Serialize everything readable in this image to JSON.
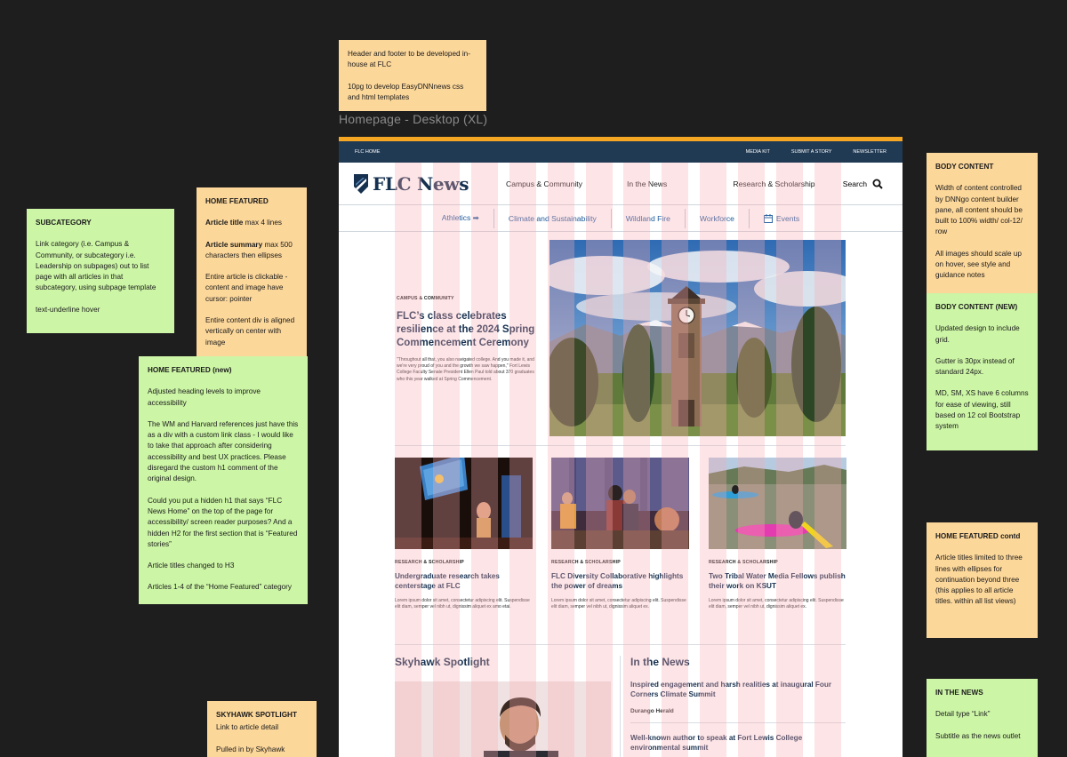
{
  "frame_label": "Homepage - Desktop (XL)",
  "notes": {
    "header_footer": {
      "line1": "Header and footer to be developed in-house at FLC",
      "line2": "10pg to develop EasyDNNnews css and html templates"
    },
    "subcategory": {
      "title": "SUBCATEGORY",
      "p1": "Link category (i.e. Campus & Community, or subcategory i.e. Leadership on subpages) out to list page with all articles in that subcategory, using subpage template",
      "p2": "text-underline hover"
    },
    "home_featured": {
      "title": "HOME FEATURED",
      "p1_bold": "Article title",
      "p1_rest": " max 4 lines",
      "p2_bold": "Article summary",
      "p2_rest": " max 500 characters then ellipses",
      "p3": "Entire article is clickable - content and image have cursor: pointer",
      "p4": "Entire content div is aligned vertically on center with image"
    },
    "home_featured_new": {
      "title": "HOME FEATURED (new)",
      "p1": "Adjusted heading levels to improve accessibility",
      "p2": "The WM and Harvard references just have this as a div with a custom link class - I would like to take that approach after considering accessibility and best UX practices. Please disregard the custom h1 comment of the original design.",
      "p3": "Could you put a hidden h1 that says “FLC News Home” on the top of the page for accessibility/ screen reader purposes? And a hidden H2 for the first section that is “Featured stories”",
      "p4": "Article titles changed to H3",
      "p5": "Articles 1-4 of the “Home Featured” category"
    },
    "skyhawk_spotlight": {
      "title": "SKYHAWK SPOTLIGHT",
      "p1": "Link to article detail",
      "p2": "Pulled in by Skyhawk"
    },
    "body_content": {
      "title": "BODY CONTENT",
      "p1": "Width of content controlled by DNNgo content builder pane, all content should be built to 100% width/ col-12/ row",
      "p2": "All images should scale up on hover, see style and guidance notes"
    },
    "body_content_new": {
      "title": "BODY CONTENT (NEW)",
      "p1": "Updated design to include grid.",
      "p2": "Gutter is 30px instead of standard 24px.",
      "p3": "MD, SM, XS have 6 columns for ease of viewing, still based on 12 col Bootstrap system"
    },
    "home_featured_contd": {
      "title": "HOME FEATURED contd",
      "p1": "Article titles limited to three lines with ellipses for continuation beyond three (this applies to all article titles. within all list views)"
    },
    "in_the_news": {
      "title": "IN THE NEWS",
      "p1": "Detail type “Link”",
      "p2": "Subtitle as the news outlet"
    }
  },
  "utility_bar": {
    "home": "FLC HOME",
    "media_kit": "MEDIA KIT",
    "submit_story": "SUBMIT A STORY",
    "newsletter": "NEWSLETTER"
  },
  "header": {
    "logo_text": "FLC News",
    "nav": [
      "Campus & Community",
      "In the News",
      "Research & Scholarship"
    ],
    "search_label": "Search"
  },
  "subnav": {
    "athletics": "Athletics ➡",
    "climate": "Climate and Sustainability",
    "wildland": "Wildland Fire",
    "workforce": "Workforce",
    "events": "Events"
  },
  "hero": {
    "category": "CAMPUS & COMMUNITY",
    "title": "FLC’s class celebrates resilience at the 2024 Spring Commencement Ceremony",
    "summary": "\"Throughout all that, you also navigated college. And you made it, and we're very proud of you and the growth we saw happen,\" Fort Lewis College Faculty Senate President Ellen Paul told about 370 graduates who this year walked at Spring Commencement."
  },
  "cards": [
    {
      "category": "RESEARCH & SCHOLARSHIP",
      "title": "Undergraduate research takes centerstage at FLC",
      "summary": "Lorem ipsum dolor sit amet, consectetur adipiscing elit. Suspendisse elit diam, semper vel nibh ut, dignissim aliquet ex amo etai."
    },
    {
      "category": "RESEARCH & SCHOLARSHIP",
      "title": "FLC Diversity Collaborative highlights the power of dreams",
      "summary": "Lorem ipsum dolor sit amet, consectetur adipiscing elit. Suspendisse elit diam, semper vel nibh ut, dignissim aliquet ex."
    },
    {
      "category": "RESEARCH & SCHOLARSHIP",
      "title": "Two Tribal Water Media Fellows publish their work on KSUT",
      "summary": "Lorem ipsum dolor sit amet, consectetur adipiscing elit. Suspendisse elit diam, semper vel nibh ut, dignissim aliquet ex."
    }
  ],
  "skyhawk_spotlight": {
    "heading": "Skyhawk Spotlight"
  },
  "in_the_news": {
    "heading": "In the News",
    "items": [
      {
        "title": "Inspired engagement and harsh realities at inaugural Four Corners Climate Summit",
        "source": "Durango Herald"
      },
      {
        "title": "Well-known author to speak at Fort Lewis College environmental summit",
        "source": ""
      }
    ]
  },
  "colors": {
    "navy": "#16304f",
    "utility_bar": "#203a54",
    "accent": "#f5a623",
    "link_blue": "#1d5a9c",
    "note_green": "#ccf5a6",
    "note_orange": "#fcd79a"
  }
}
